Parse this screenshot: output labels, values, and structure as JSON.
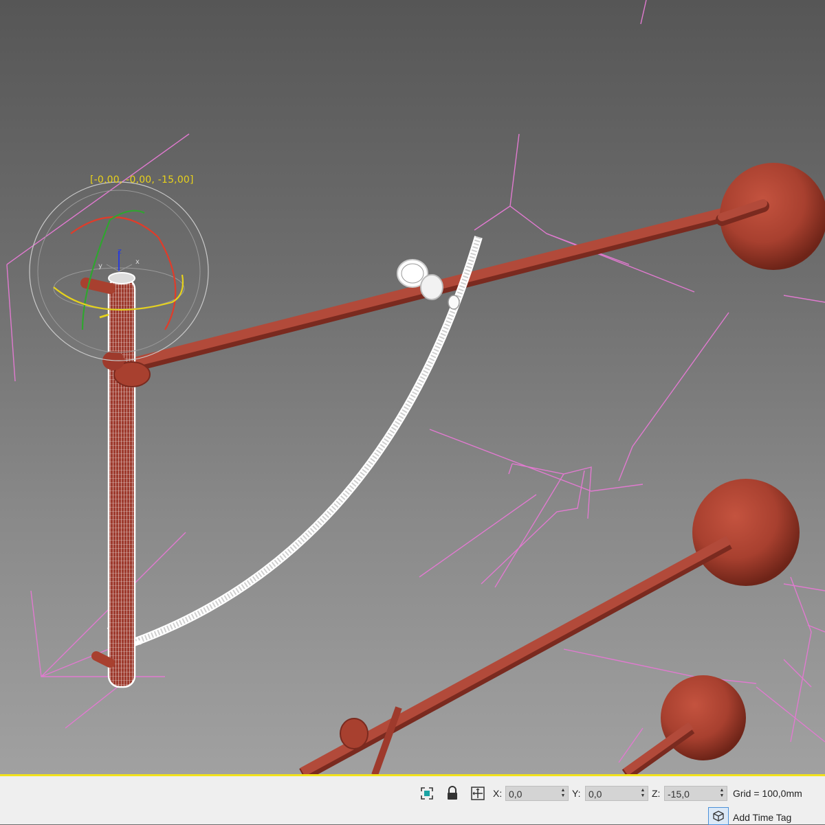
{
  "viewport": {
    "transform_readout": "[-0,00, -0,00, -15,00]",
    "gizmo_axes": {
      "x": "x",
      "y": "y",
      "z": "z"
    },
    "colors": {
      "object": "#b5473a",
      "selection_box": "#e17ad0",
      "wireframe": "#ffffff",
      "readout": "#e8d21a",
      "axis_x": "#e03c2a",
      "axis_y": "#2fa62f",
      "axis_z": "#2a3cd8",
      "rotate_view": "#e6d21c"
    }
  },
  "statusbar": {
    "icons": [
      "selection-toggle-icon",
      "lock-icon",
      "absolute-offset-icon",
      "time-tag-icon"
    ],
    "x_label": "X:",
    "x_value": "0,0",
    "y_label": "Y:",
    "y_value": "0,0",
    "z_label": "Z:",
    "z_value": "-15,0",
    "grid": "Grid = 100,0mm",
    "time_tag": "Add Time Tag",
    "border_color": "#f2e21b"
  }
}
